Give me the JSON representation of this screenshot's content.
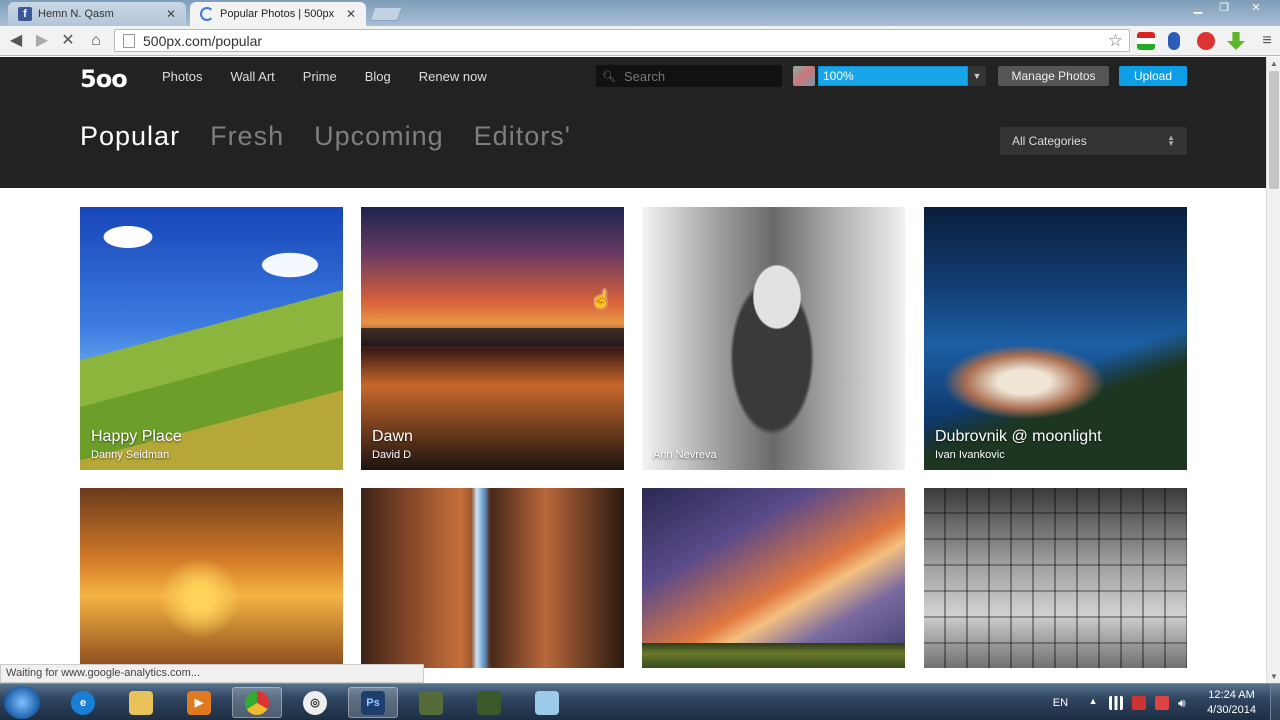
{
  "browser": {
    "tabs": [
      {
        "label": "Hemn N. Qasm",
        "favicon": "facebook-icon",
        "active": false
      },
      {
        "label": "Popular Photos | 500px",
        "favicon": "loading-spinner-icon",
        "active": true
      }
    ],
    "url": "500px.com/popular",
    "status_text": "Waiting for www.google-analytics.com...",
    "icons": [
      "back-icon",
      "forward-icon",
      "reload-icon",
      "home-icon",
      "star-icon",
      "menu-icon"
    ]
  },
  "site": {
    "logo": "5oo",
    "nav": [
      "Photos",
      "Wall Art",
      "Prime",
      "Blog",
      "Renew now"
    ],
    "search_placeholder": "Search",
    "upload_progress": {
      "label": "100%",
      "fraction": 1.0
    },
    "manage_photos": "Manage Photos",
    "upload": "Upload",
    "feed_tabs": [
      {
        "label": "Popular",
        "current": true
      },
      {
        "label": "Fresh",
        "current": false
      },
      {
        "label": "Upcoming",
        "current": false
      },
      {
        "label": "Editors'",
        "current": false
      }
    ],
    "category_select": "All Categories",
    "colors": {
      "header_bg": "#222222",
      "accent": "#0d9ee6"
    }
  },
  "photos": [
    {
      "title": "Happy Place",
      "author": "Danny Seidman"
    },
    {
      "title": "Dawn",
      "author": "David D"
    },
    {
      "title": "",
      "author": "Ann Nevreva"
    },
    {
      "title": "Dubrovnik @ moonlight",
      "author": "Ivan Ivankovic"
    },
    {
      "title": "",
      "author": ""
    },
    {
      "title": "",
      "author": ""
    },
    {
      "title": "",
      "author": ""
    },
    {
      "title": "",
      "author": ""
    }
  ],
  "taskbar": {
    "apps": [
      "internet-explorer-icon",
      "file-explorer-icon",
      "media-player-icon",
      "chrome-icon",
      "app-icon",
      "photoshop-icon",
      "app-icon",
      "app-icon",
      "app-icon"
    ],
    "language": "EN",
    "time": "12:24 AM",
    "date": "4/30/2014"
  }
}
